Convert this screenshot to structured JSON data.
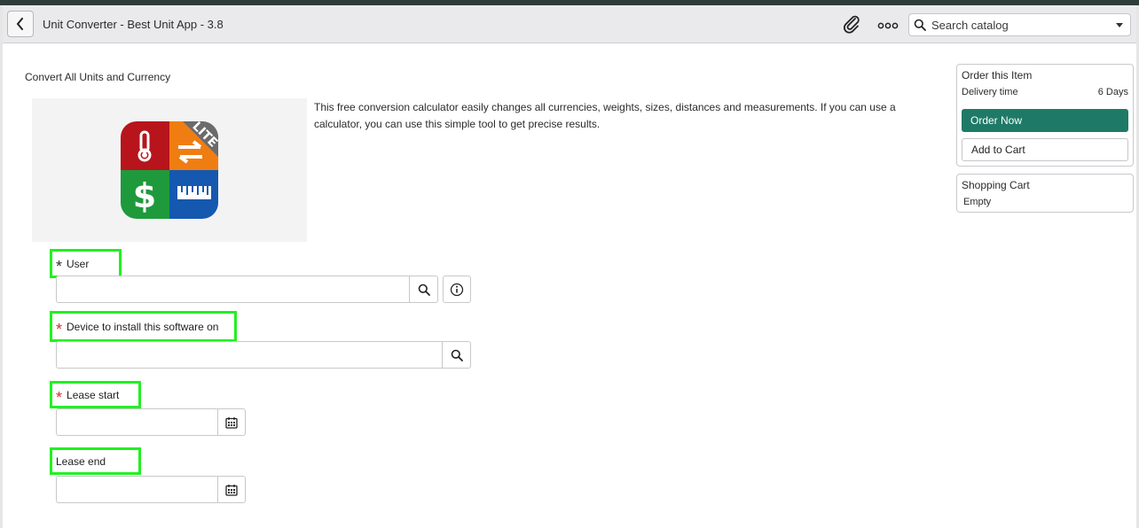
{
  "header": {
    "title": "Unit Converter - Best Unit App - 3.8",
    "search_placeholder": "Search catalog"
  },
  "page": {
    "heading": "Convert All Units and Currency",
    "description": "This free conversion calculator easily changes all currencies, weights, sizes, distances and measurements. If you can use a calculator, you can use this simple tool to get precise results.",
    "app_icon_badge": "LITE"
  },
  "form": {
    "user_label": "User",
    "device_label": "Device to install this software on",
    "lease_start_label": "Lease start",
    "lease_end_label": "Lease end",
    "required_mark": "*"
  },
  "order_panel": {
    "title": "Order this Item",
    "delivery_label": "Delivery time",
    "delivery_value": "6 Days",
    "order_now": "Order Now",
    "add_to_cart": "Add to Cart"
  },
  "cart_panel": {
    "title": "Shopping Cart",
    "status": "Empty"
  },
  "colors": {
    "accent": "#1e7a66",
    "highlight": "#22f022",
    "required_red": "#d32f2f"
  },
  "icons": [
    "chevron-left-icon",
    "paperclip-icon",
    "more-icon",
    "search-icon",
    "caret-down-icon",
    "info-icon",
    "calendar-icon"
  ]
}
